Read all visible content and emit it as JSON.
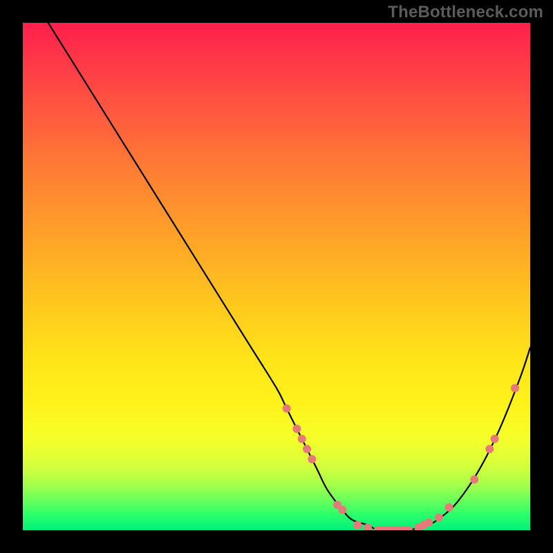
{
  "watermark": "TheBottleneck.com",
  "colors": {
    "background": "#000000",
    "curve_stroke": "#000000",
    "marker_fill": "#e67a7a",
    "marker_stroke": "#c95a5a"
  },
  "chart_data": {
    "type": "line",
    "title": "",
    "xlabel": "",
    "ylabel": "",
    "xlim": [
      0,
      100
    ],
    "ylim": [
      0,
      100
    ],
    "grid": false,
    "series": [
      {
        "name": "curve",
        "x": [
          5,
          10,
          15,
          20,
          25,
          30,
          35,
          40,
          45,
          50,
          52,
          55,
          58,
          60,
          63,
          65,
          68,
          70,
          73,
          76,
          78,
          80,
          83,
          86,
          90,
          94,
          98,
          100
        ],
        "values": [
          100,
          92,
          84,
          76,
          68,
          60,
          52,
          44,
          36,
          28,
          24,
          18,
          12,
          8,
          4,
          2,
          1,
          0,
          0,
          0,
          0.5,
          1,
          3,
          6,
          12,
          20,
          30,
          36
        ]
      }
    ],
    "markers": [
      {
        "x": 52,
        "y": 24
      },
      {
        "x": 54,
        "y": 20
      },
      {
        "x": 55,
        "y": 18
      },
      {
        "x": 56,
        "y": 16
      },
      {
        "x": 57,
        "y": 14
      },
      {
        "x": 62,
        "y": 5
      },
      {
        "x": 63,
        "y": 4
      },
      {
        "x": 66,
        "y": 1
      },
      {
        "x": 68,
        "y": 0.5
      },
      {
        "x": 70,
        "y": 0
      },
      {
        "x": 71,
        "y": 0
      },
      {
        "x": 72,
        "y": 0
      },
      {
        "x": 73,
        "y": 0
      },
      {
        "x": 74,
        "y": 0
      },
      {
        "x": 75,
        "y": 0
      },
      {
        "x": 76,
        "y": 0
      },
      {
        "x": 78,
        "y": 0.5
      },
      {
        "x": 79,
        "y": 1
      },
      {
        "x": 80,
        "y": 1.5
      },
      {
        "x": 82,
        "y": 2.5
      },
      {
        "x": 84,
        "y": 4.5
      },
      {
        "x": 89,
        "y": 10
      },
      {
        "x": 92,
        "y": 16
      },
      {
        "x": 93,
        "y": 18
      },
      {
        "x": 97,
        "y": 28
      }
    ]
  }
}
